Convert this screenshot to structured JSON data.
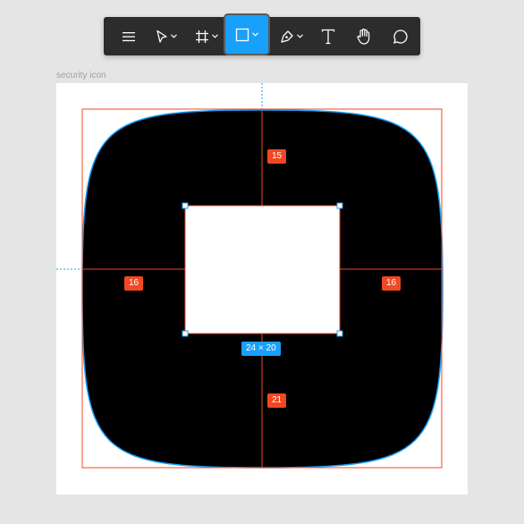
{
  "toolbar": {
    "tools": [
      {
        "id": "menu",
        "icon": "menu-icon"
      },
      {
        "id": "move",
        "icon": "cursor-icon",
        "dropdown": true
      },
      {
        "id": "frame",
        "icon": "frame-icon",
        "dropdown": true
      },
      {
        "id": "rectangle",
        "icon": "rectangle-icon",
        "dropdown": true,
        "active": true
      },
      {
        "id": "pen",
        "icon": "pen-icon",
        "dropdown": true
      },
      {
        "id": "text",
        "icon": "text-icon"
      },
      {
        "id": "hand",
        "icon": "hand-icon"
      },
      {
        "id": "comment",
        "icon": "comment-icon"
      }
    ],
    "active_color": "#18a0fb"
  },
  "frame": {
    "name": "security icon"
  },
  "measurements": {
    "top": "15",
    "left": "16",
    "right": "16",
    "bottom": "21",
    "selection_size": "24 × 20"
  },
  "colors": {
    "measure": "#f24822",
    "selection": "#18a0fb",
    "shape_fill": "#000000",
    "canvas": "#e5e5e5"
  }
}
